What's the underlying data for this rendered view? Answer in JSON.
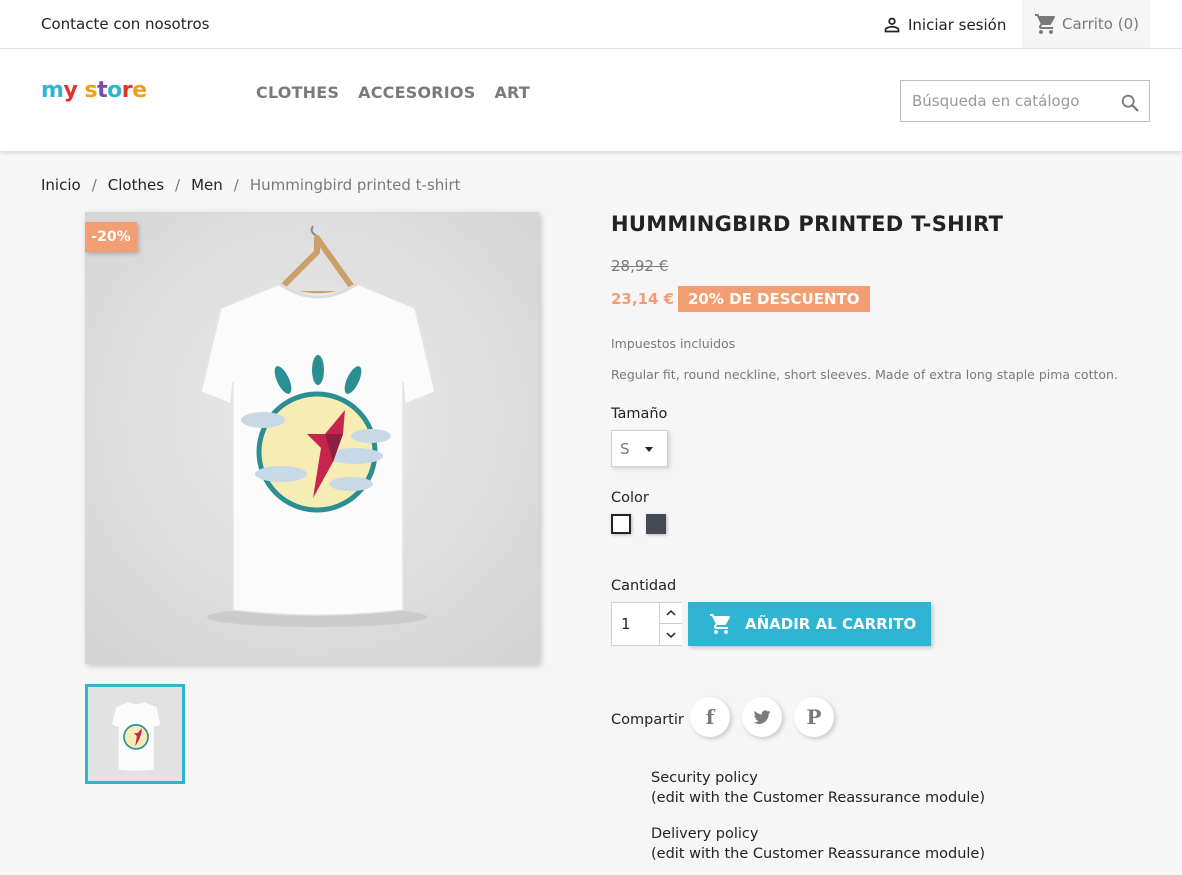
{
  "topbar": {
    "contact": "Contacte con nosotros",
    "signin": "Iniciar sesión",
    "cart": "Carrito (0)"
  },
  "header": {
    "logo": "my store",
    "menu": [
      "CLOTHES",
      "ACCESORIOS",
      "ART"
    ],
    "search_placeholder": "Búsqueda en catálogo"
  },
  "breadcrumb": [
    "Inicio",
    "Clothes",
    "Men",
    "Hummingbird printed t-shirt"
  ],
  "product": {
    "discount_flag": "-20%",
    "name": "HUMMINGBIRD PRINTED T-SHIRT",
    "old_price": "28,92 €",
    "price": "23,14 €",
    "discount_badge": "20% DE DESCUENTO",
    "taxes": "Impuestos incluidos",
    "description": "Regular fit, round neckline, short sleeves. Made of extra long staple pima cotton.",
    "size_label": "Tamaño",
    "size_value": "S",
    "color_label": "Color",
    "colors": [
      "#ffffff",
      "#434a54"
    ],
    "quantity_label": "Cantidad",
    "quantity": "1",
    "add_to_cart": "AÑADIR AL CARRITO",
    "share_label": "Compartir"
  },
  "reassurance": [
    {
      "title": "Security policy",
      "note": "(edit with the Customer Reassurance module)"
    },
    {
      "title": "Delivery policy",
      "note": "(edit with the Customer Reassurance module)"
    }
  ],
  "colors": {
    "accent": "#2fb5d2",
    "discount": "#f39d72",
    "text": "#232323",
    "muted": "#7a7a7a"
  }
}
